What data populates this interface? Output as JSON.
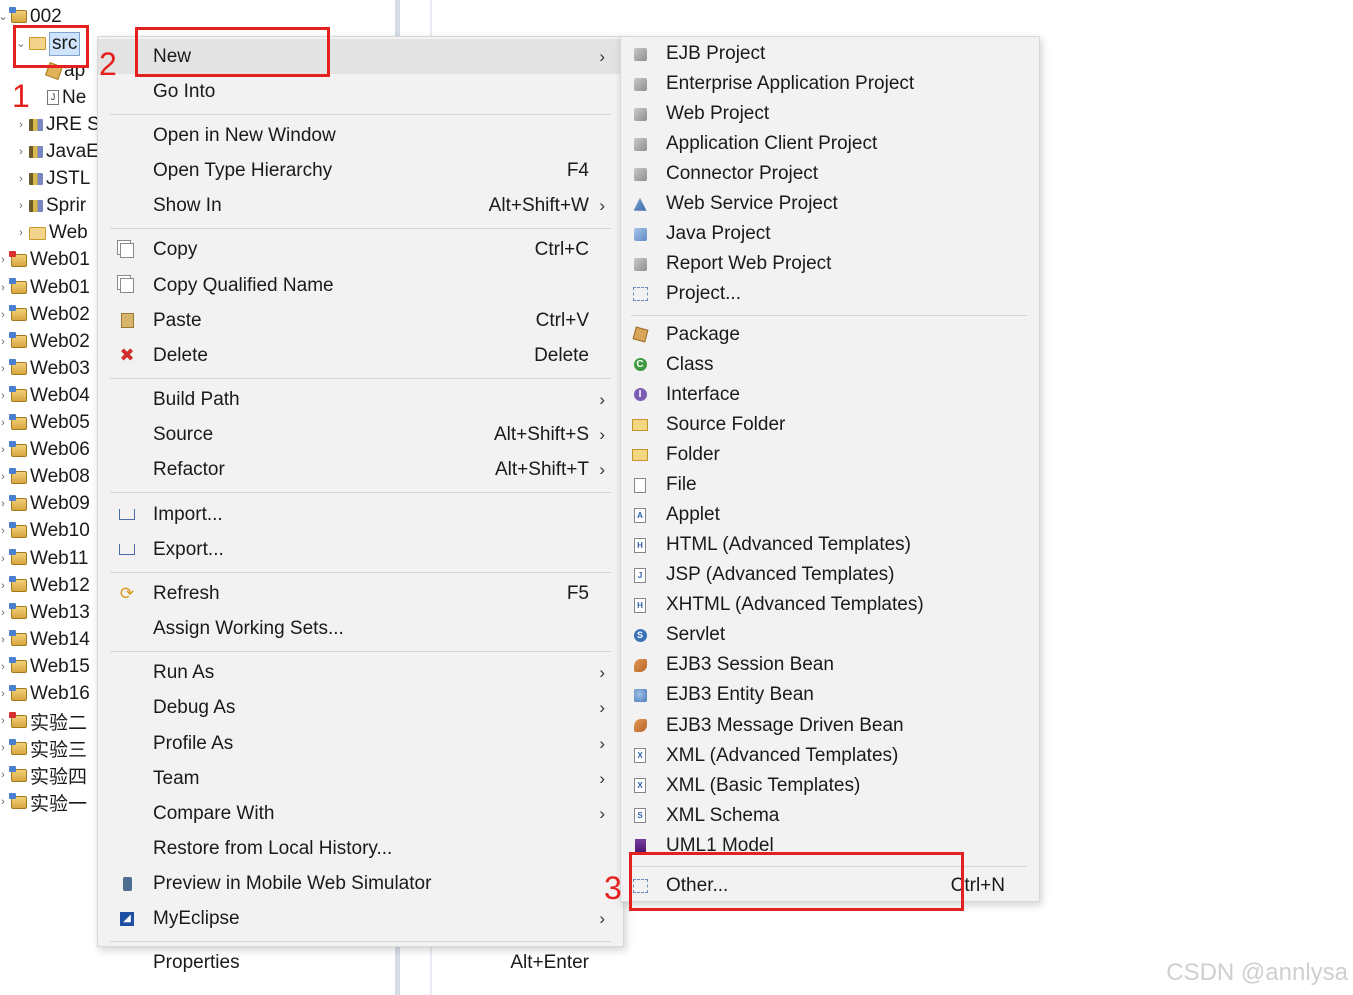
{
  "tree": {
    "items": [
      {
        "label": "002",
        "icon": "project-icon",
        "twisty": "⌄",
        "indent": 0
      },
      {
        "label": "src",
        "icon": "source-folder-icon",
        "twisty": "⌄",
        "indent": 1,
        "selected": true
      },
      {
        "label": "ap",
        "icon": "package-icon",
        "twisty": "",
        "indent": 2
      },
      {
        "label": "Ne",
        "icon": "java-file-icon",
        "twisty": "",
        "indent": 2
      },
      {
        "label": "JRE S",
        "icon": "library-icon",
        "twisty": "›",
        "indent": 1
      },
      {
        "label": "JavaE",
        "icon": "library-icon",
        "twisty": "›",
        "indent": 1
      },
      {
        "label": "JSTL",
        "icon": "library-icon",
        "twisty": "›",
        "indent": 1
      },
      {
        "label": "Sprir",
        "icon": "library-icon",
        "twisty": "›",
        "indent": 1
      },
      {
        "label": "Web",
        "icon": "folder-icon",
        "twisty": "›",
        "indent": 1
      },
      {
        "label": "Web01",
        "icon": "project-error-icon",
        "twisty": "›",
        "indent": 0
      },
      {
        "label": "Web01",
        "icon": "project-icon",
        "twisty": "›",
        "indent": 0
      },
      {
        "label": "Web02",
        "icon": "project-icon",
        "twisty": "›",
        "indent": 0
      },
      {
        "label": "Web02",
        "icon": "project-icon",
        "twisty": "›",
        "indent": 0
      },
      {
        "label": "Web03",
        "icon": "project-icon",
        "twisty": "›",
        "indent": 0
      },
      {
        "label": "Web04",
        "icon": "project-icon",
        "twisty": "›",
        "indent": 0
      },
      {
        "label": "Web05",
        "icon": "project-icon",
        "twisty": "›",
        "indent": 0
      },
      {
        "label": "Web06",
        "icon": "project-icon",
        "twisty": "›",
        "indent": 0
      },
      {
        "label": "Web08",
        "icon": "project-icon",
        "twisty": "›",
        "indent": 0
      },
      {
        "label": "Web09",
        "icon": "project-icon",
        "twisty": "›",
        "indent": 0
      },
      {
        "label": "Web10",
        "icon": "project-icon",
        "twisty": "›",
        "indent": 0
      },
      {
        "label": "Web11",
        "icon": "project-icon",
        "twisty": "›",
        "indent": 0
      },
      {
        "label": "Web12",
        "icon": "project-icon",
        "twisty": "›",
        "indent": 0
      },
      {
        "label": "Web13",
        "icon": "project-icon",
        "twisty": "›",
        "indent": 0
      },
      {
        "label": "Web14",
        "icon": "project-icon",
        "twisty": "›",
        "indent": 0
      },
      {
        "label": "Web15",
        "icon": "project-icon",
        "twisty": "›",
        "indent": 0
      },
      {
        "label": "Web16",
        "icon": "project-icon",
        "twisty": "›",
        "indent": 0
      },
      {
        "label": "实验二",
        "icon": "project-error-icon",
        "twisty": "›",
        "indent": 0
      },
      {
        "label": "实验三",
        "icon": "project-icon",
        "twisty": "›",
        "indent": 0
      },
      {
        "label": "实验四",
        "icon": "project-icon",
        "twisty": "›",
        "indent": 0
      },
      {
        "label": "实验一",
        "icon": "project-icon",
        "twisty": "›",
        "indent": 0
      }
    ]
  },
  "context_menu": {
    "items": [
      {
        "label": "New",
        "shortcut": "",
        "submenu": true,
        "icon": "",
        "highlighted": true
      },
      {
        "label": "Go Into",
        "shortcut": "",
        "submenu": false,
        "icon": ""
      },
      {
        "sep": true
      },
      {
        "label": "Open in New Window",
        "shortcut": "",
        "submenu": false,
        "icon": ""
      },
      {
        "label": "Open Type Hierarchy",
        "shortcut": "F4",
        "submenu": false,
        "icon": ""
      },
      {
        "label": "Show In",
        "shortcut": "Alt+Shift+W",
        "submenu": true,
        "icon": ""
      },
      {
        "sep": true
      },
      {
        "label": "Copy",
        "shortcut": "Ctrl+C",
        "submenu": false,
        "icon": "copy-icon"
      },
      {
        "label": "Copy Qualified Name",
        "shortcut": "",
        "submenu": false,
        "icon": "copy-qualified-icon"
      },
      {
        "label": "Paste",
        "shortcut": "Ctrl+V",
        "submenu": false,
        "icon": "paste-icon"
      },
      {
        "label": "Delete",
        "shortcut": "Delete",
        "submenu": false,
        "icon": "delete-icon"
      },
      {
        "sep": true
      },
      {
        "label": "Build Path",
        "shortcut": "",
        "submenu": true,
        "icon": ""
      },
      {
        "label": "Source",
        "shortcut": "Alt+Shift+S",
        "submenu": true,
        "icon": ""
      },
      {
        "label": "Refactor",
        "shortcut": "Alt+Shift+T",
        "submenu": true,
        "icon": ""
      },
      {
        "sep": true
      },
      {
        "label": "Import...",
        "shortcut": "",
        "submenu": false,
        "icon": "import-icon"
      },
      {
        "label": "Export...",
        "shortcut": "",
        "submenu": false,
        "icon": "export-icon"
      },
      {
        "sep": true
      },
      {
        "label": "Refresh",
        "shortcut": "F5",
        "submenu": false,
        "icon": "refresh-icon"
      },
      {
        "label": "Assign Working Sets...",
        "shortcut": "",
        "submenu": false,
        "icon": ""
      },
      {
        "sep": true
      },
      {
        "label": "Run As",
        "shortcut": "",
        "submenu": true,
        "icon": ""
      },
      {
        "label": "Debug As",
        "shortcut": "",
        "submenu": true,
        "icon": ""
      },
      {
        "label": "Profile As",
        "shortcut": "",
        "submenu": true,
        "icon": ""
      },
      {
        "label": "Team",
        "shortcut": "",
        "submenu": true,
        "icon": ""
      },
      {
        "label": "Compare With",
        "shortcut": "",
        "submenu": true,
        "icon": ""
      },
      {
        "label": "Restore from Local History...",
        "shortcut": "",
        "submenu": false,
        "icon": ""
      },
      {
        "label": "Preview in Mobile Web Simulator",
        "shortcut": "",
        "submenu": false,
        "icon": "mobile-simulator-icon"
      },
      {
        "label": "MyEclipse",
        "shortcut": "",
        "submenu": true,
        "icon": "myeclipse-icon"
      },
      {
        "sep": true
      },
      {
        "label": "Properties",
        "shortcut": "Alt+Enter",
        "submenu": false,
        "icon": ""
      }
    ]
  },
  "new_submenu": {
    "items": [
      {
        "label": "EJB Project",
        "shortcut": "",
        "icon": "ejb-project-icon"
      },
      {
        "label": "Enterprise Application Project",
        "shortcut": "",
        "icon": "enterprise-project-icon"
      },
      {
        "label": "Web Project",
        "shortcut": "",
        "icon": "web-project-icon"
      },
      {
        "label": "Application Client Project",
        "shortcut": "",
        "icon": "app-client-project-icon"
      },
      {
        "label": "Connector Project",
        "shortcut": "",
        "icon": "connector-project-icon"
      },
      {
        "label": "Web Service Project",
        "shortcut": "",
        "icon": "web-service-project-icon"
      },
      {
        "label": "Java Project",
        "shortcut": "",
        "icon": "java-project-icon"
      },
      {
        "label": "Report Web Project",
        "shortcut": "",
        "icon": "report-web-project-icon"
      },
      {
        "label": "Project...",
        "shortcut": "",
        "icon": "project-wizard-icon"
      },
      {
        "sep": true
      },
      {
        "label": "Package",
        "shortcut": "",
        "icon": "package-icon"
      },
      {
        "label": "Class",
        "shortcut": "",
        "icon": "class-icon"
      },
      {
        "label": "Interface",
        "shortcut": "",
        "icon": "interface-icon"
      },
      {
        "label": "Source Folder",
        "shortcut": "",
        "icon": "source-folder-icon"
      },
      {
        "label": "Folder",
        "shortcut": "",
        "icon": "folder-icon"
      },
      {
        "label": "File",
        "shortcut": "",
        "icon": "file-icon"
      },
      {
        "label": "Applet",
        "shortcut": "",
        "icon": "applet-icon"
      },
      {
        "label": "HTML (Advanced Templates)",
        "shortcut": "",
        "icon": "html-file-icon"
      },
      {
        "label": "JSP (Advanced Templates)",
        "shortcut": "",
        "icon": "jsp-file-icon"
      },
      {
        "label": "XHTML (Advanced Templates)",
        "shortcut": "",
        "icon": "xhtml-file-icon"
      },
      {
        "label": "Servlet",
        "shortcut": "",
        "icon": "servlet-icon"
      },
      {
        "label": "EJB3 Session Bean",
        "shortcut": "",
        "icon": "session-bean-icon"
      },
      {
        "label": "EJB3 Entity Bean",
        "shortcut": "",
        "icon": "entity-bean-icon"
      },
      {
        "label": "EJB3 Message Driven Bean",
        "shortcut": "",
        "icon": "message-bean-icon"
      },
      {
        "label": "XML (Advanced Templates)",
        "shortcut": "",
        "icon": "xml-file-icon"
      },
      {
        "label": "XML (Basic Templates)",
        "shortcut": "",
        "icon": "xml-basic-file-icon"
      },
      {
        "label": "XML Schema",
        "shortcut": "",
        "icon": "xml-schema-icon"
      },
      {
        "label": "UML1 Model",
        "shortcut": "",
        "icon": "uml-model-icon"
      },
      {
        "sep": true
      },
      {
        "label": "Other...",
        "shortcut": "Ctrl+N",
        "icon": "other-wizard-icon"
      }
    ]
  },
  "annotations": {
    "n1": "1",
    "n2": "2",
    "n3": "3",
    "color": "#e5211f"
  },
  "watermark": "CSDN @annlysa"
}
